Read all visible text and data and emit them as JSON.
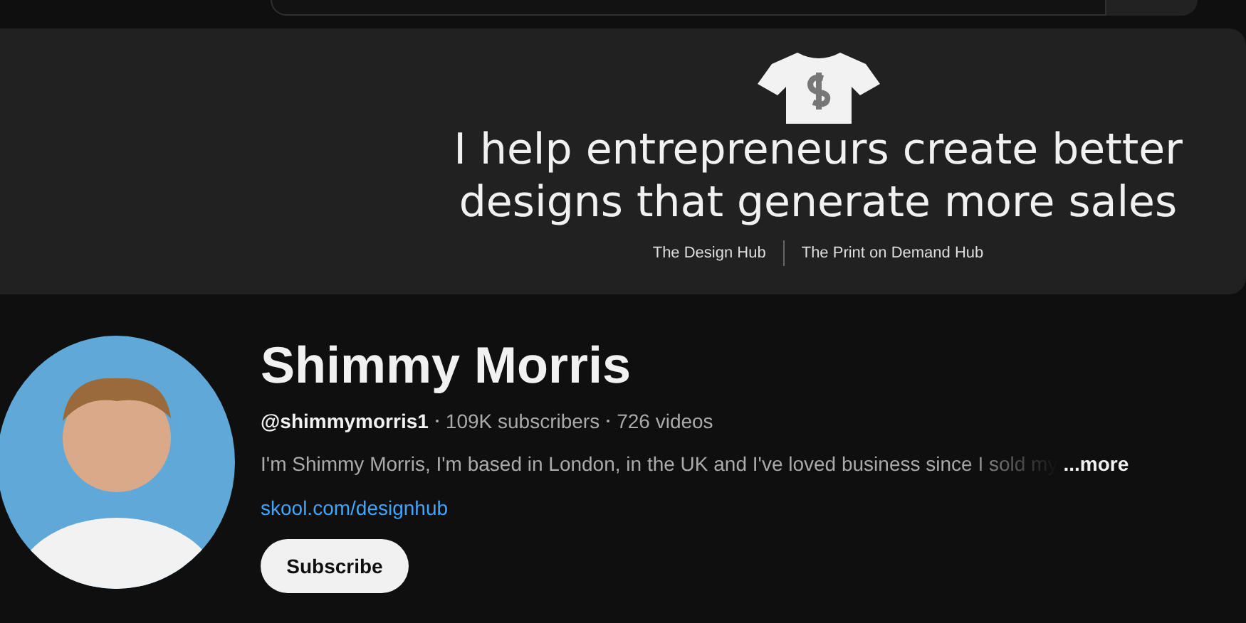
{
  "banner": {
    "headline": [
      "I help entrepreneurs create better",
      "designs that generate more sales"
    ],
    "links": [
      "The Design Hub",
      "The Print on Demand Hub"
    ]
  },
  "channel": {
    "name": "Shimmy Morris",
    "handle": "@shimmymorris1",
    "stats": [
      "109K subscribers",
      "726 videos"
    ],
    "description": "I'm Shimmy Morris, I'm based in London, in the UK and I've loved business since I sold my",
    "more": "...more",
    "link": "skool.com/designhub",
    "subscribe": "Subscribe"
  }
}
